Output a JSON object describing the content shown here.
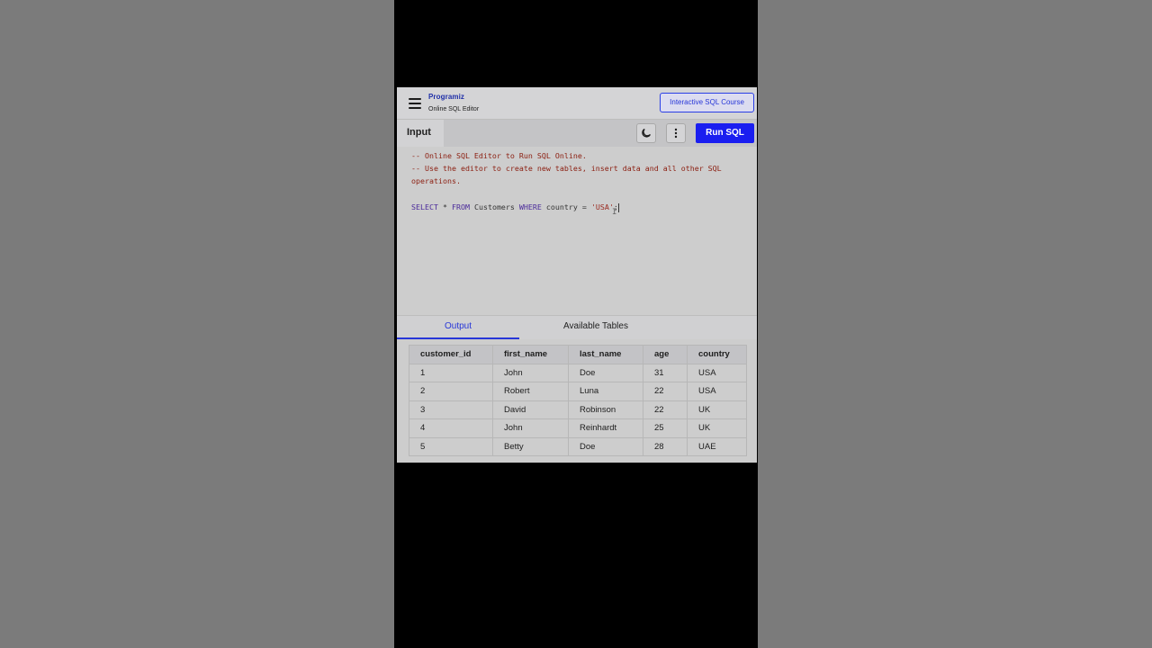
{
  "brand": {
    "name": "Programiz",
    "subtitle": "Online SQL Editor"
  },
  "header": {
    "course_button": "Interactive SQL Course"
  },
  "toolbar": {
    "input_tab": "Input",
    "run_button": "Run SQL"
  },
  "editor": {
    "comments": [
      "-- Online SQL Editor to Run SQL Online.",
      "-- Use the editor to create new tables, insert data and all other SQL",
      "operations."
    ],
    "query": {
      "kw_select": "SELECT",
      "star": " * ",
      "kw_from": "FROM",
      "table": " Customers ",
      "kw_where": "WHERE",
      "cond": " country = ",
      "value": "'USA'",
      "end": ";"
    }
  },
  "output_tabs": {
    "output": "Output",
    "tables": "Available Tables"
  },
  "table": {
    "columns": [
      "customer_id",
      "first_name",
      "last_name",
      "age",
      "country"
    ],
    "rows": [
      [
        "1",
        "John",
        "Doe",
        "31",
        "USA"
      ],
      [
        "2",
        "Robert",
        "Luna",
        "22",
        "USA"
      ],
      [
        "3",
        "David",
        "Robinson",
        "22",
        "UK"
      ],
      [
        "4",
        "John",
        "Reinhardt",
        "25",
        "UK"
      ],
      [
        "5",
        "Betty",
        "Doe",
        "28",
        "UAE"
      ]
    ]
  },
  "icons": [
    "menu-icon",
    "moon-icon",
    "more-vertical-icon"
  ],
  "colors": {
    "accent": "#1a1ef0",
    "brand": "#1f2fa8",
    "comment": "#8b1d0f"
  }
}
